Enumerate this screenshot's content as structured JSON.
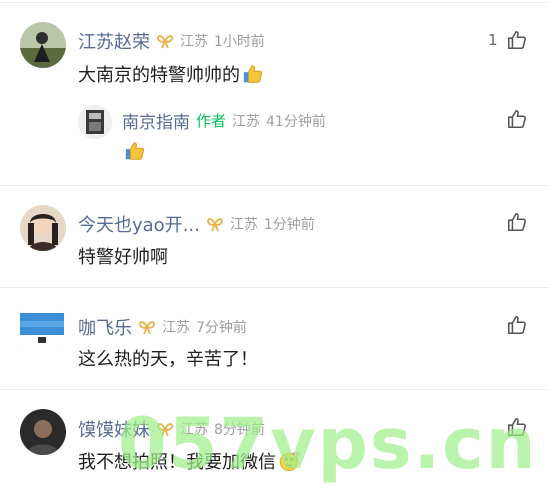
{
  "comments": [
    {
      "name": "江苏赵荣",
      "location": "江苏",
      "time": "1小时前",
      "text": "大南京的特警帅帅的",
      "like_count": "1",
      "badge_icon": "ribbon-badge-icon",
      "reply": {
        "name": "南京指南",
        "author_tag": "作者",
        "location": "江苏",
        "time": "41分钟前",
        "text": ""
      }
    },
    {
      "name": "今天也yao开...",
      "location": "江苏",
      "time": "1分钟前",
      "text": "特警好帅啊",
      "like_count": ""
    },
    {
      "name": "咖飞乐",
      "location": "江苏",
      "time": "7分钟前",
      "text": "这么热的天，辛苦了！",
      "like_count": ""
    },
    {
      "name": "馍馍妹妹",
      "location": "江苏",
      "time": "8分钟前",
      "text": "我不想拍照！我要加微信",
      "like_count": ""
    }
  ],
  "watermark": "057vps.cn",
  "colors": {
    "name": "#576b95",
    "author": "#07c160",
    "badge": "#e8b44a",
    "meta": "#9e9e9e"
  }
}
